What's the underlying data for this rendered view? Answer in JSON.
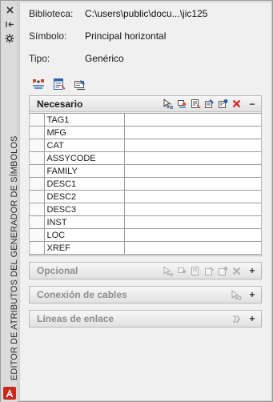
{
  "palette": {
    "title": "EDITOR DE ATRIBUTOS DEL GENERADOR DE SÍMBOLOS"
  },
  "info": {
    "library_label": "Biblioteca:",
    "library_value": "C:\\users\\public\\docu...\\jic125",
    "symbol_label": "Símbolo:",
    "symbol_value": "Principal horizontal",
    "type_label": "Tipo:",
    "type_value": "Genérico"
  },
  "panels": {
    "required": {
      "title": "Necesario",
      "toggle": "−"
    },
    "optional": {
      "title": "Opcional",
      "toggle": "+"
    },
    "wires": {
      "title": "Conexión de cables",
      "toggle": "+"
    },
    "links": {
      "title": "Líneas de enlace",
      "toggle": "+"
    }
  },
  "attributes": [
    "TAG1",
    "MFG",
    "CAT",
    "ASSYCODE",
    "FAMILY",
    "DESC1",
    "DESC2",
    "DESC3",
    "INST",
    "LOC",
    "XREF"
  ],
  "colors": {
    "delete_red": "#d42020",
    "accent_blue": "#2a5fb0"
  }
}
